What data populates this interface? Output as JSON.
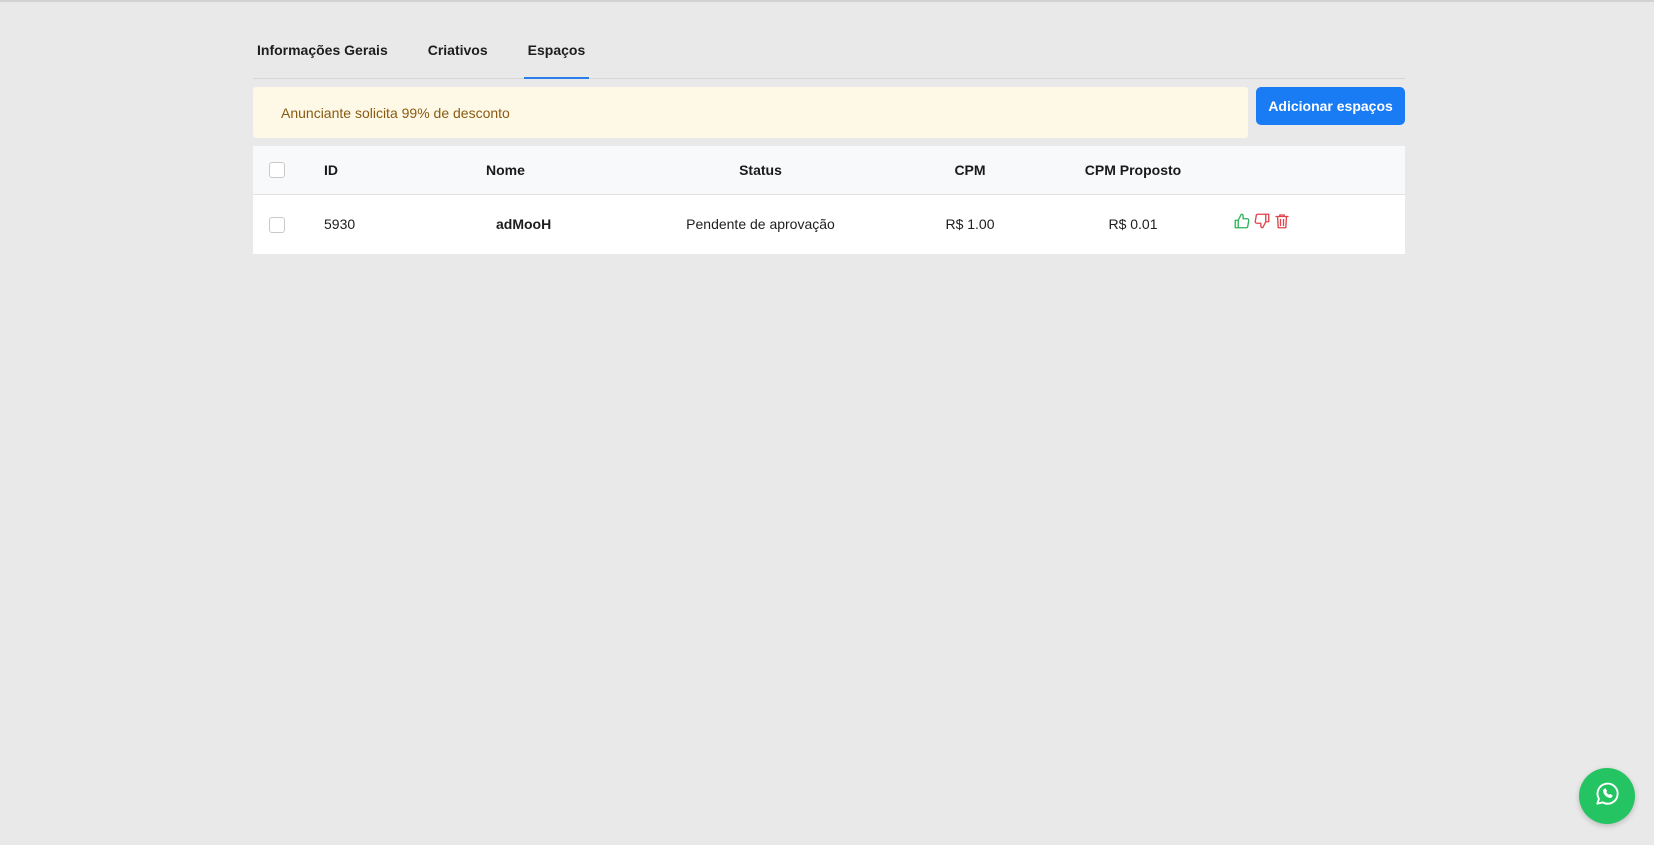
{
  "tabs": [
    {
      "label": "Informações Gerais",
      "active": false
    },
    {
      "label": "Criativos",
      "active": false
    },
    {
      "label": "Espaços",
      "active": true
    }
  ],
  "alert": {
    "text": "Anunciante solicita 99% de desconto"
  },
  "add_button": {
    "label": "Adicionar espaços"
  },
  "table": {
    "headers": {
      "id": "ID",
      "nome": "Nome",
      "status": "Status",
      "cpm": "CPM",
      "cpm_proposto": "CPM Proposto"
    },
    "rows": [
      {
        "id": "5930",
        "nome": "adMooH",
        "status": "Pendente de aprovação",
        "cpm": "R$ 1.00",
        "cpm_proposto": "R$ 0.01"
      }
    ]
  },
  "icons": {
    "approve": "thumbs-up-icon",
    "reject": "thumbs-down-icon",
    "delete": "trash-icon",
    "chat": "whatsapp-icon"
  },
  "colors": {
    "accent": "#1a7cf5",
    "alert_bg": "#fdf9e6",
    "alert_text": "#8a5a12",
    "approve": "#2fb35a",
    "reject": "#e0434b",
    "whatsapp": "#25c462"
  }
}
